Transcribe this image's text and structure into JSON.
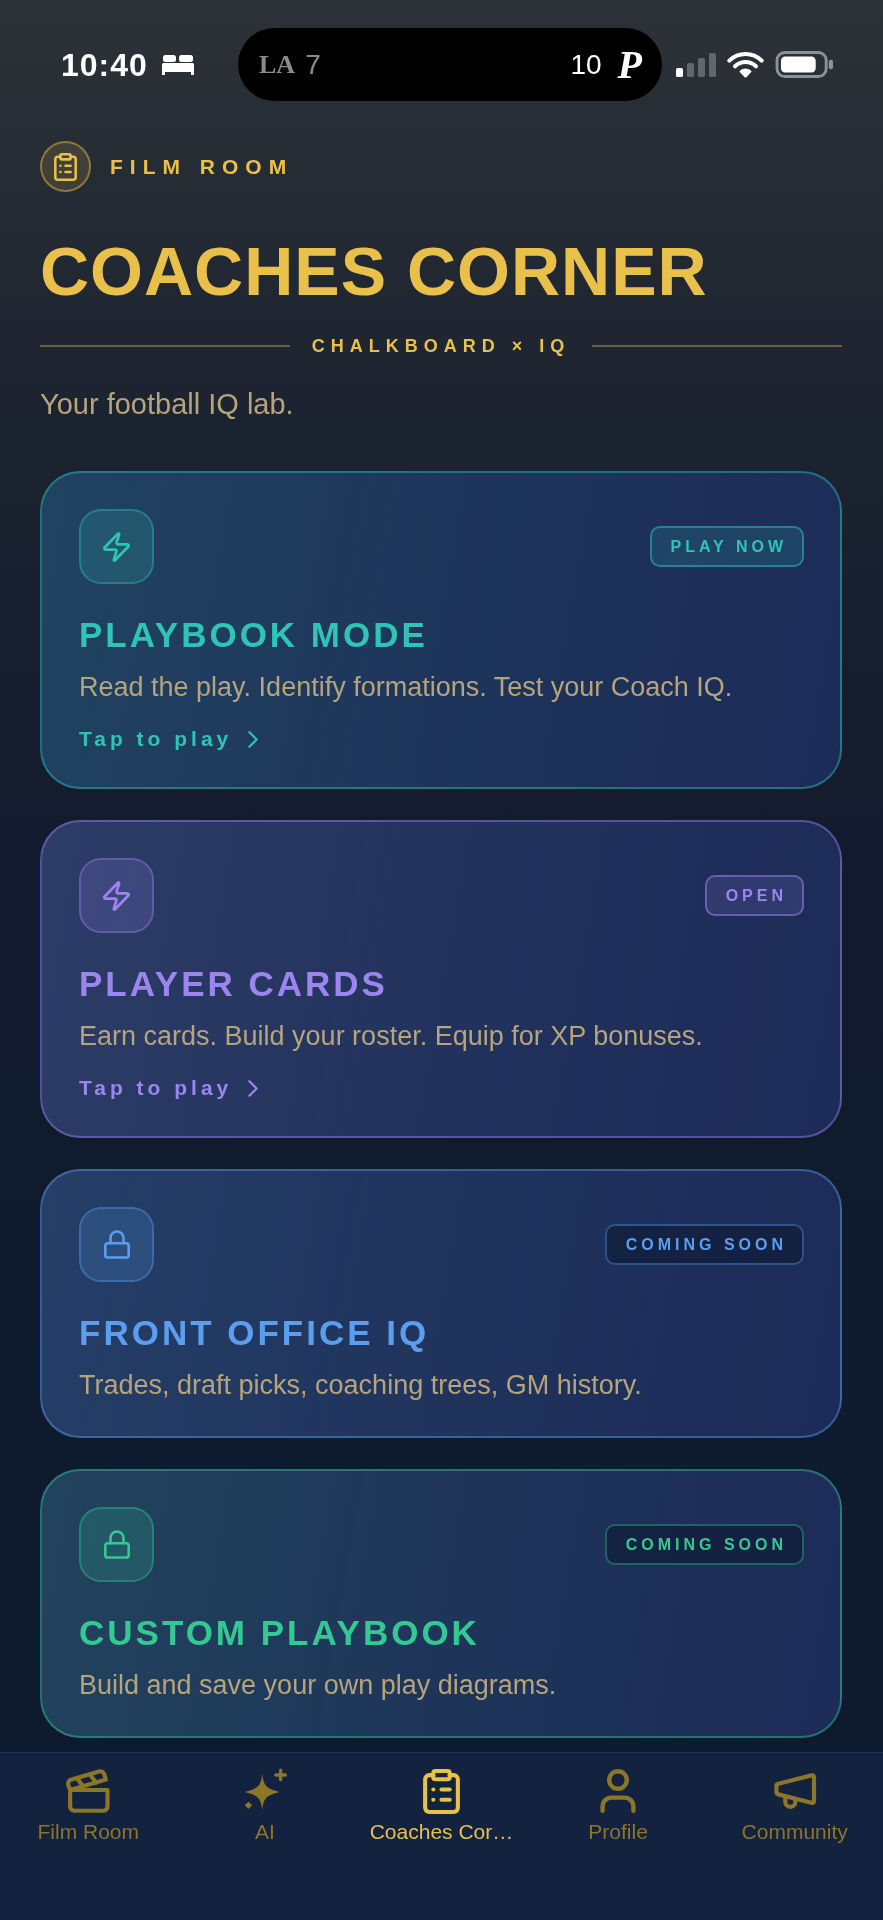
{
  "status_bar": {
    "time": "10:40",
    "live_activity": {
      "away_logo": "LA",
      "away_score": "7",
      "home_score": "10",
      "home_logo": "P"
    }
  },
  "header": {
    "eyebrow": "FILM ROOM",
    "title": "COACHES CORNER",
    "divider_label": "CHALKBOARD × IQ",
    "subtitle": "Your football IQ lab."
  },
  "cards": [
    {
      "kind": "playable",
      "color": "#2ec4b6",
      "badge": "PLAY NOW",
      "title": "PLAYBOOK MODE",
      "description": "Read the play. Identify formations. Test your Coach IQ.",
      "action": "Tap to play"
    },
    {
      "kind": "playable",
      "color": "#9d85f0",
      "badge": "OPEN",
      "title": "PLAYER CARDS",
      "description": "Earn cards. Build your roster. Equip for XP bonuses.",
      "action": "Tap to play"
    },
    {
      "kind": "locked",
      "color": "#5b9ef0",
      "badge": "COMING SOON",
      "title": "FRONT OFFICE IQ",
      "description": "Trades, draft picks, coaching trees, GM history."
    },
    {
      "kind": "locked",
      "color": "#34c994",
      "badge": "COMING SOON",
      "title": "CUSTOM PLAYBOOK",
      "description": "Build and save your own play diagrams."
    }
  ],
  "tab_bar": {
    "items": [
      {
        "label": "Film Room",
        "selected": false
      },
      {
        "label": "AI",
        "selected": false
      },
      {
        "label": "Coaches Cor…",
        "selected": true
      },
      {
        "label": "Profile",
        "selected": false
      },
      {
        "label": "Community",
        "selected": false
      }
    ]
  }
}
